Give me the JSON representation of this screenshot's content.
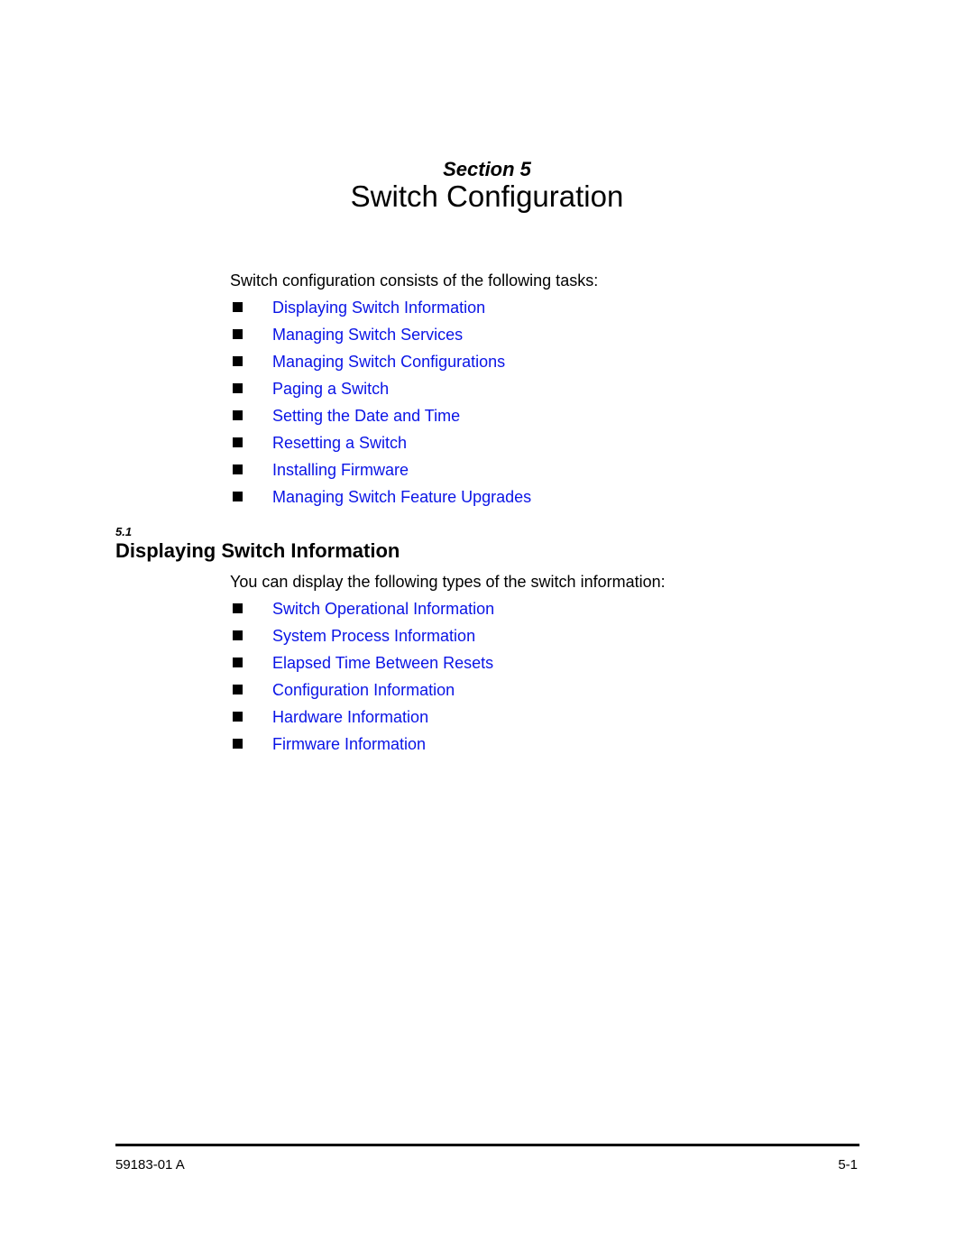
{
  "header": {
    "section_label": "Section 5",
    "title": "Switch Configuration"
  },
  "intro": {
    "text": "Switch configuration consists of the following tasks:",
    "items": [
      {
        "label": "Displaying Switch Information"
      },
      {
        "label": "Managing Switch Services"
      },
      {
        "label": "Managing Switch Configurations"
      },
      {
        "label": "Paging a Switch"
      },
      {
        "label": "Setting the Date and Time"
      },
      {
        "label": "Resetting a Switch"
      },
      {
        "label": "Installing Firmware"
      },
      {
        "label": "Managing Switch Feature Upgrades"
      }
    ]
  },
  "section_5_1": {
    "number": "5.1",
    "heading": "Displaying Switch Information",
    "text": "You can display the following types of the switch information:",
    "items": [
      {
        "label": "Switch Operational Information"
      },
      {
        "label": "System Process Information"
      },
      {
        "label": "Elapsed Time Between Resets"
      },
      {
        "label": "Configuration Information"
      },
      {
        "label": "Hardware Information"
      },
      {
        "label": "Firmware Information"
      }
    ]
  },
  "footer": {
    "doc_id": "59183-01 A",
    "page_number": "5-1"
  },
  "colors": {
    "link": "#0a14e6",
    "text": "#000000"
  }
}
